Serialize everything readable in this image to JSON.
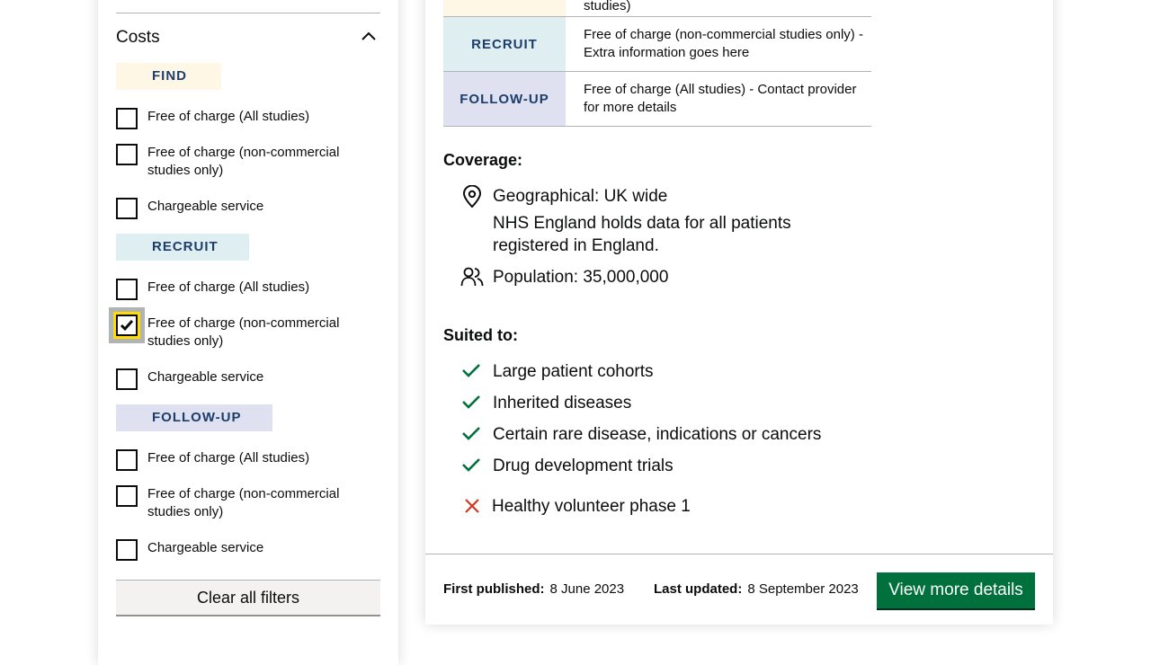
{
  "filters": {
    "costs_title": "Costs",
    "groups": [
      {
        "tag": "FIND",
        "options": [
          {
            "label": "Free of charge (All studies)",
            "checked": false
          },
          {
            "label": "Free of charge (non-commercial studies only)",
            "checked": false
          },
          {
            "label": "Chargeable service",
            "checked": false
          }
        ]
      },
      {
        "tag": "RECRUIT",
        "options": [
          {
            "label": "Free of charge (All studies)",
            "checked": false
          },
          {
            "label": "Free of charge (non-commercial studies only)",
            "checked": true
          },
          {
            "label": "Chargeable service",
            "checked": false
          }
        ]
      },
      {
        "tag": "FOLLOW-UP",
        "options": [
          {
            "label": "Free of charge (All studies)",
            "checked": false
          },
          {
            "label": "Free of charge (non-commercial studies only)",
            "checked": false
          },
          {
            "label": "Chargeable service",
            "checked": false
          }
        ]
      }
    ],
    "clear_label": "Clear all filters"
  },
  "card": {
    "costs": {
      "top_partial_text": "studies)",
      "rows": [
        {
          "tag": "RECRUIT",
          "text": "Free of charge (non-commercial studies only) - Extra information goes here",
          "color": "#dfeef0"
        },
        {
          "tag": "FOLLOW-UP",
          "text": "Free of charge (All studies) - Contact provider for more details",
          "color": "#dfe0f0"
        }
      ]
    },
    "coverage": {
      "heading": "Coverage:",
      "geographical": "Geographical: UK wide",
      "note": "NHS England holds data for all patients registered in England.",
      "population": "Population: 35,000,000"
    },
    "suited": {
      "heading": "Suited to:",
      "yes": [
        "Large patient cohorts",
        "Inherited diseases",
        "Certain rare disease, indications or cancers",
        "Drug development trials"
      ],
      "no": [
        "Healthy volunteer phase 1"
      ]
    },
    "footer": {
      "first_published_label": "First published:",
      "first_published_value": "8 June 2023",
      "last_updated_label": "Last updated:",
      "last_updated_value": "8 September 2023",
      "view_button": "View more details"
    }
  },
  "colors": {
    "primary_green": "#00703c",
    "focus_yellow": "#ffdd00",
    "error_red": "#d4351c",
    "tag_text": "#1d3d6b",
    "find_bg": "#fff7e6",
    "recruit_bg": "#dfeef0",
    "follow_bg": "#dfe0f0"
  },
  "icons": {
    "costs_toggle": "chevron-up-icon",
    "geography": "location-pin-icon",
    "population": "people-icon",
    "suited_yes": "check-icon",
    "suited_no": "cross-icon",
    "checkbox_checked": "check-icon"
  }
}
